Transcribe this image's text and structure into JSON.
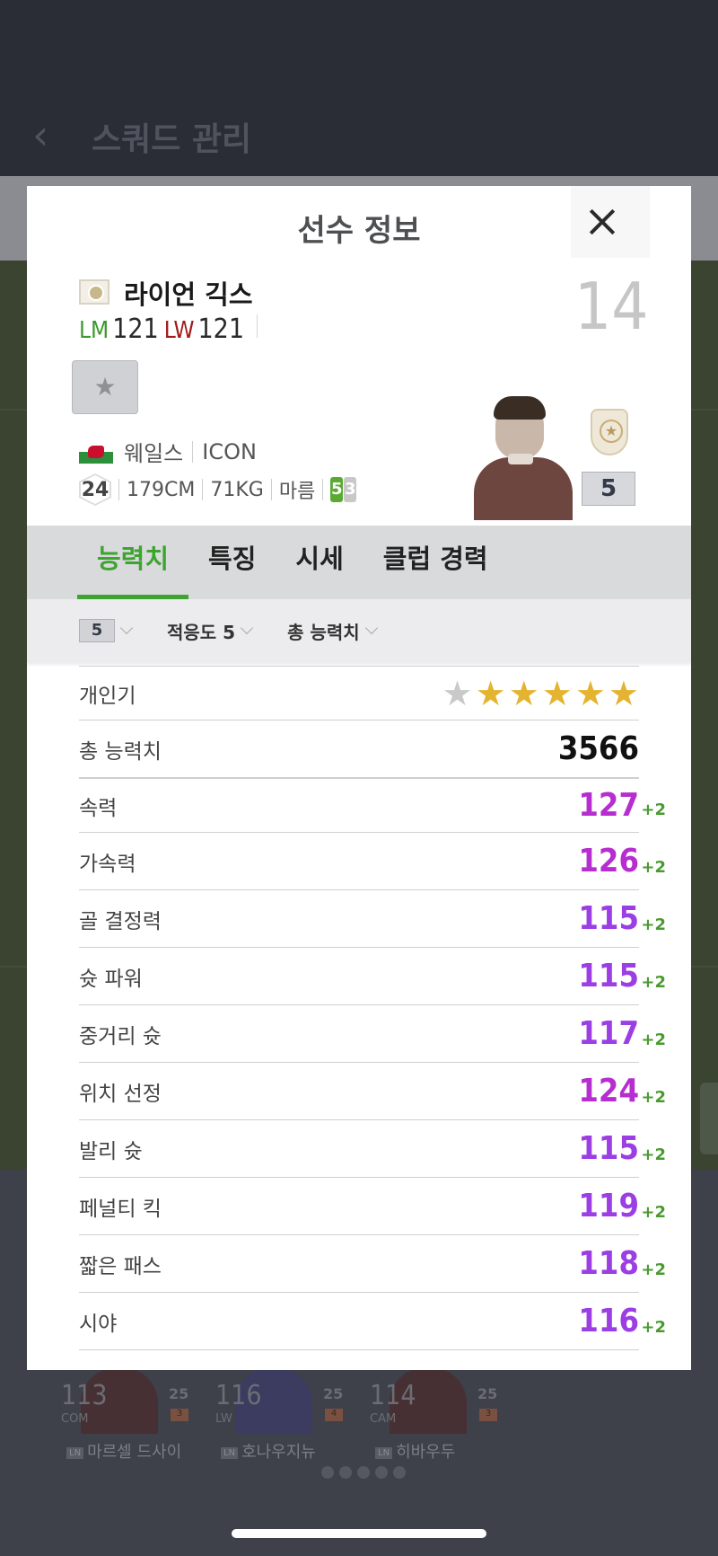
{
  "background": {
    "back_glyph": "‹",
    "title": "스쿼드 관리",
    "cards": [
      {
        "ovr": "113",
        "pos": "COM",
        "level": "25",
        "grade": "3",
        "tag": "LN",
        "name": "마르셀 드사이"
      },
      {
        "ovr": "116",
        "pos": "LW",
        "level": "25",
        "grade": "4",
        "tag": "LN",
        "name": "호나우지뉴"
      },
      {
        "ovr": "114",
        "pos": "CAM",
        "level": "25",
        "grade": "3",
        "tag": "LN",
        "name": "히바우두"
      }
    ]
  },
  "modal": {
    "title": "선수 정보",
    "player": {
      "name": "라이언 긱스",
      "positions": [
        {
          "pos": "LM",
          "value": "121",
          "color": "#3a9a2a"
        },
        {
          "pos": "LW",
          "value": "121",
          "color": "#a21a1a"
        }
      ],
      "jersey_number": "14",
      "fav_glyph": "★",
      "nation": "웨일스",
      "season": "ICON",
      "age": "24",
      "height": "179CM",
      "weight": "71KG",
      "body_type": "마름",
      "foot_strong": "5",
      "foot_weak": "3",
      "level": "5"
    },
    "tabs": [
      "능력치",
      "특징",
      "시세",
      "클럽 경력"
    ],
    "active_tab": "능력치",
    "filters": {
      "level": "5",
      "adaptation": "적응도 5",
      "sort": "총 능력치"
    },
    "reputation_label": "개인기",
    "reputation_stars": 5,
    "reputation_max": 6,
    "total_label": "총 능력치",
    "total_value": "3566",
    "stats": [
      {
        "label": "속력",
        "value": "127",
        "bonus": "+2",
        "color": "#b62ecf"
      },
      {
        "label": "가속력",
        "value": "126",
        "bonus": "+2",
        "color": "#b62ecf"
      },
      {
        "label": "골 결정력",
        "value": "115",
        "bonus": "+2",
        "color": "#9b3ee4"
      },
      {
        "label": "슛 파워",
        "value": "115",
        "bonus": "+2",
        "color": "#9b3ee4"
      },
      {
        "label": "중거리 슛",
        "value": "117",
        "bonus": "+2",
        "color": "#9b3ee4"
      },
      {
        "label": "위치 선정",
        "value": "124",
        "bonus": "+2",
        "color": "#b62ecf"
      },
      {
        "label": "발리 슛",
        "value": "115",
        "bonus": "+2",
        "color": "#9b3ee4"
      },
      {
        "label": "페널티 킥",
        "value": "119",
        "bonus": "+2",
        "color": "#9b3ee4"
      },
      {
        "label": "짧은 패스",
        "value": "118",
        "bonus": "+2",
        "color": "#9b3ee4"
      },
      {
        "label": "시야",
        "value": "116",
        "bonus": "+2",
        "color": "#9b3ee4"
      }
    ],
    "colors": {
      "accent": "#3ea430",
      "bonus": "#4a9a30"
    }
  }
}
